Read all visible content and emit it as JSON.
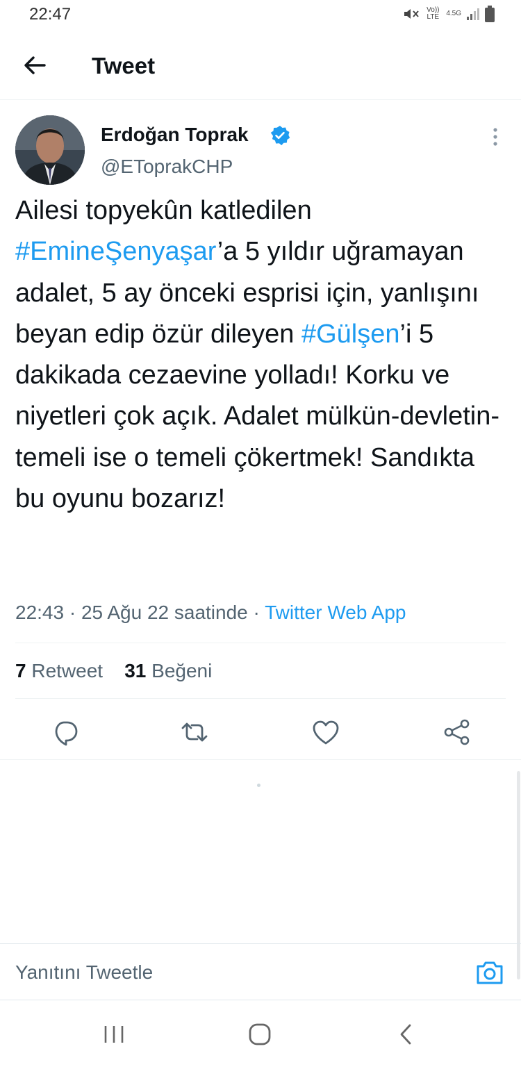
{
  "status_bar": {
    "time": "22:47",
    "volte_label": "Vo)) LTE",
    "network_label": "4.5G"
  },
  "header": {
    "title": "Tweet",
    "back_icon": "arrow-left-icon"
  },
  "tweet": {
    "author_name": "Erdoğan Toprak",
    "author_handle": "@EToprakCHP",
    "verified": true,
    "text": {
      "part1": "Ailesi topyekûn katledilen ",
      "hashtag1": "#EmineŞenyaşar",
      "part2": "’a 5 yıldır uğramayan adalet, 5 ay önceki esprisi için, yanlışını beyan edip özür dileyen ",
      "hashtag2": "#Gülşen",
      "part3": "’i 5 dakikada cezaevine yolladı! Korku ve niyetleri çok açık. Adalet mülkün-devletin-temeli ise o temeli çökertmek! Sandıkta bu oyunu bozarız!"
    },
    "time": "22:43",
    "date": "25 Ağu 22 saatinde",
    "separator": "·",
    "source": "Twitter Web App",
    "retweet_count": "7",
    "retweet_label": "Retweet",
    "like_count": "31",
    "like_label": "Beğeni"
  },
  "actions": [
    "reply-icon",
    "retweet-icon",
    "like-icon",
    "share-icon"
  ],
  "reply_bar": {
    "placeholder": "Yanıtını Tweetle"
  },
  "colors": {
    "link": "#1d9bf0",
    "secondary_text": "#536471",
    "primary_text": "#0f1419"
  }
}
